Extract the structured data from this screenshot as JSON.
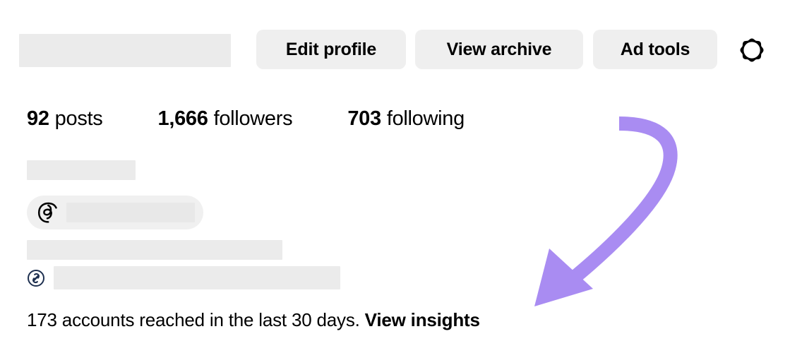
{
  "header": {
    "username_redacted": true,
    "buttons": [
      {
        "id": "edit-profile",
        "label": "Edit profile"
      },
      {
        "id": "view-archive",
        "label": "View archive"
      },
      {
        "id": "ad-tools",
        "label": "Ad tools"
      }
    ],
    "settings_icon": "gear-icon"
  },
  "stats": [
    {
      "value": "92",
      "label": "posts"
    },
    {
      "value": "1,666",
      "label": "followers"
    },
    {
      "value": "703",
      "label": "following"
    }
  ],
  "bio": {
    "display_name_redacted": true,
    "threads_badge": {
      "icon": "threads-icon",
      "handle_redacted": true
    },
    "bio_text_redacted": true,
    "link": {
      "icon": "link-icon",
      "url_redacted": true
    }
  },
  "insights": {
    "text": "173 accounts reached in the last 30 days.",
    "link_label": "View insights",
    "accounts_reached": "173",
    "period": "last 30 days"
  },
  "annotation": {
    "type": "curved-arrow",
    "color": "#a98cf2",
    "points_to": "View insights"
  },
  "colors": {
    "page_background": "#ffffff",
    "button_background": "#efefef",
    "redaction": "#ebebeb",
    "pill_background": "#f0f0f0",
    "text": "#000000",
    "link_icon": "#1e3050",
    "annotation_purple": "#a98cf2"
  }
}
